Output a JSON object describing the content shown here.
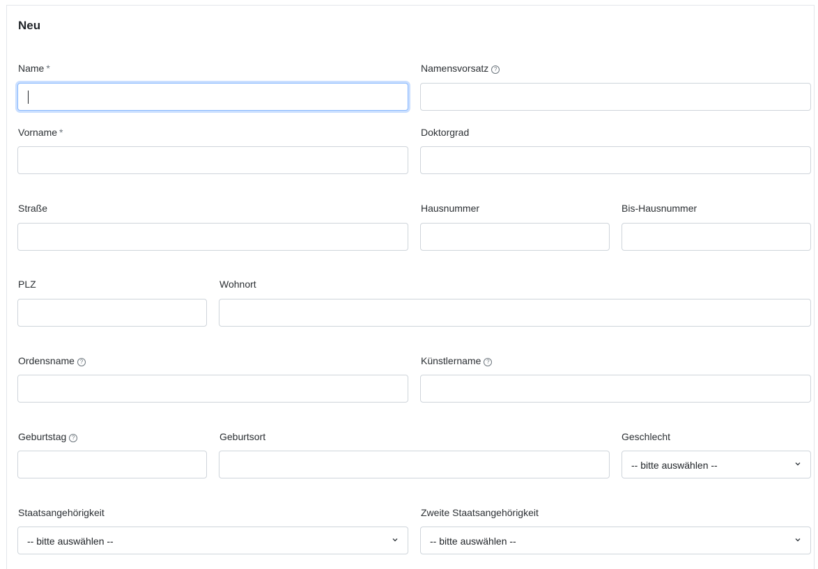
{
  "form": {
    "title": "Neu",
    "required_mark": "*",
    "help_glyph": "?",
    "fields": {
      "name": {
        "label": "Name",
        "value": ""
      },
      "namensvorsatz": {
        "label": "Namensvorsatz"
      },
      "vorname": {
        "label": "Vorname"
      },
      "doktorgrad": {
        "label": "Doktorgrad"
      },
      "strasse": {
        "label": "Straße"
      },
      "hausnummer": {
        "label": "Hausnummer"
      },
      "bis_hausnummer": {
        "label": "Bis-Hausnummer"
      },
      "plz": {
        "label": "PLZ"
      },
      "wohnort": {
        "label": "Wohnort"
      },
      "ordensname": {
        "label": "Ordensname"
      },
      "kuenstlername": {
        "label": "Künstlername"
      },
      "geburtstag": {
        "label": "Geburtstag"
      },
      "geburtsort": {
        "label": "Geburtsort"
      },
      "geschlecht": {
        "label": "Geschlecht",
        "selected": "-- bitte auswählen --"
      },
      "staatsangehoerigkeit": {
        "label": "Staatsangehörigkeit",
        "selected": "-- bitte auswählen --"
      },
      "zweite_staatsangehoerigkeit": {
        "label": "Zweite Staatsangehörigkeit",
        "selected": "-- bitte auswählen --"
      }
    }
  },
  "colors": {
    "focus_border": "#86b7fe",
    "input_border": "#ced4da"
  },
  "icons": {
    "help": "help-circle-icon",
    "dropdown": "chevron-down-icon"
  }
}
